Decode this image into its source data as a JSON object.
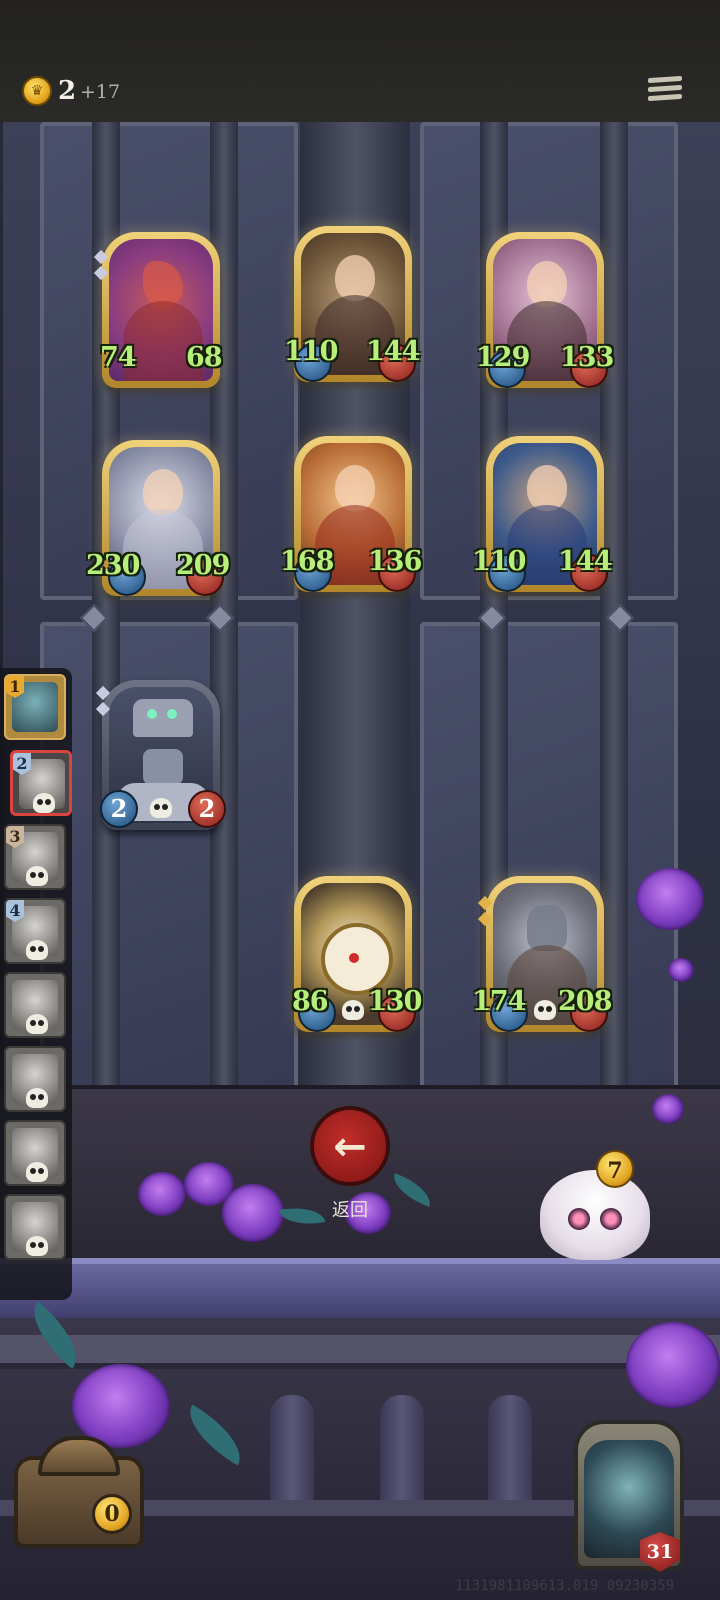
{
  "header": {
    "gold": "2",
    "gold_income": "+17"
  },
  "board": {
    "cards": [
      {
        "id": "c1",
        "atk": "74",
        "hp": "68"
      },
      {
        "id": "c2",
        "atk": "110",
        "hp": "144"
      },
      {
        "id": "c3",
        "atk": "129",
        "hp": "133"
      },
      {
        "id": "c4",
        "atk": "230",
        "hp": "209"
      },
      {
        "id": "c5",
        "atk": "168",
        "hp": "136"
      },
      {
        "id": "c6",
        "atk": "110",
        "hp": "144"
      },
      {
        "id": "c7",
        "atk": "2",
        "hp": "2"
      },
      {
        "id": "c8",
        "atk": "86",
        "hp": "130"
      },
      {
        "id": "c9",
        "atk": "174",
        "hp": "208"
      }
    ]
  },
  "timeline": {
    "items": [
      {
        "num": "1"
      },
      {
        "num": "2"
      },
      {
        "num": "3"
      },
      {
        "num": "4"
      },
      {
        "num": ""
      },
      {
        "num": ""
      },
      {
        "num": ""
      },
      {
        "num": ""
      }
    ]
  },
  "return_button": {
    "label": "返回"
  },
  "mascot": {
    "coin": "7"
  },
  "chest": {
    "count": "0"
  },
  "hero": {
    "hp": "31"
  },
  "footer": {
    "build_id": "1131981109613.019 09230359"
  },
  "colors": {
    "stat_text": "#b8ef7a",
    "attack": "#2c5f93",
    "health": "#b02a24",
    "card_gold": "#d9b25a"
  }
}
